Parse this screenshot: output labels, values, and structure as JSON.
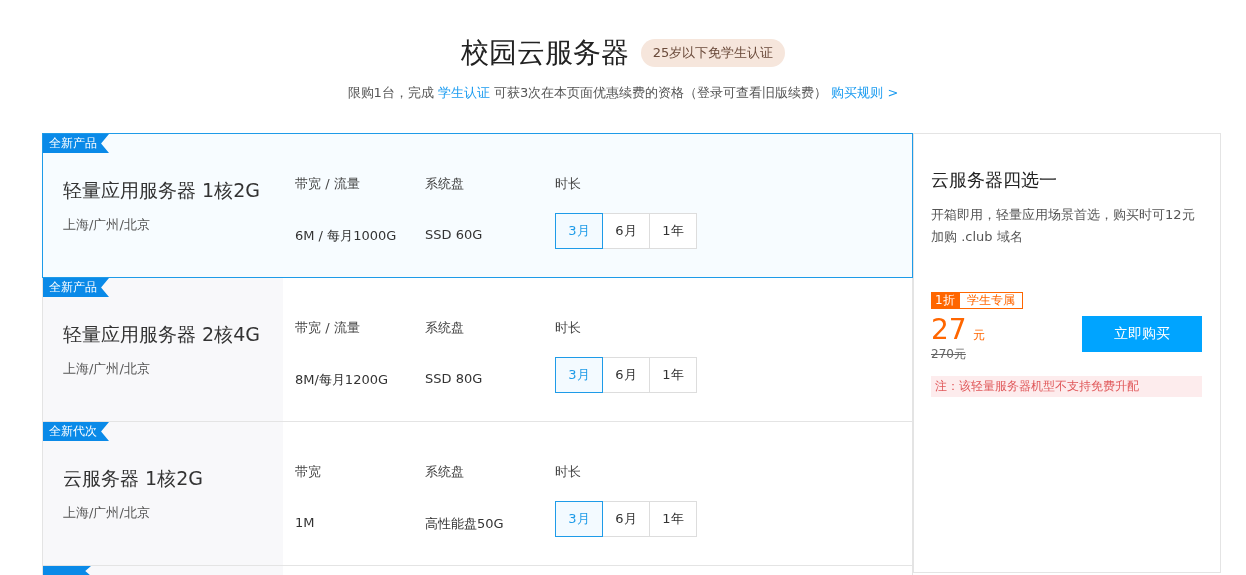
{
  "header": {
    "title": "校园云服务器",
    "badge": "25岁以下免学生认证",
    "subtitle": [
      {
        "kind": "text",
        "text": "限购1台，完成 "
      },
      {
        "kind": "link",
        "text": "学生认证"
      },
      {
        "kind": "text",
        "text": " 可获3次在本页面优惠续费的资格（登录可查看旧版续费） "
      },
      {
        "kind": "link",
        "text": "购买规则 >"
      }
    ]
  },
  "products": [
    {
      "tag": "全新产品",
      "name": "轻量应用服务器 1核2G",
      "regions": "上海/广州/北京",
      "selected": true,
      "specs": [
        {
          "label": "带宽 / 流量",
          "value": "6M / 每月1000G"
        },
        {
          "label": "系统盘",
          "value": "SSD 60G"
        }
      ],
      "duration_label": "时长",
      "durations": [
        {
          "label": "3月",
          "selected": true
        },
        {
          "label": "6月",
          "selected": false
        },
        {
          "label": "1年",
          "selected": false
        }
      ]
    },
    {
      "tag": "全新产品",
      "name": "轻量应用服务器 2核4G",
      "regions": "上海/广州/北京",
      "selected": false,
      "specs": [
        {
          "label": "带宽 / 流量",
          "value": "8M/每月1200G"
        },
        {
          "label": "系统盘",
          "value": "SSD 80G"
        }
      ],
      "duration_label": "时长",
      "durations": [
        {
          "label": "3月",
          "selected": true
        },
        {
          "label": "6月",
          "selected": false
        },
        {
          "label": "1年",
          "selected": false
        }
      ]
    },
    {
      "tag": "全新代次",
      "name": "云服务器 1核2G",
      "regions": "上海/广州/北京",
      "selected": false,
      "specs": [
        {
          "label": "带宽",
          "value": "1M"
        },
        {
          "label": "系统盘",
          "value": "高性能盘50G"
        }
      ],
      "duration_label": "时长",
      "durations": [
        {
          "label": "3月",
          "selected": true
        },
        {
          "label": "6月",
          "selected": false
        },
        {
          "label": "1年",
          "selected": false
        }
      ]
    }
  ],
  "panel": {
    "title": "云服务器四选一",
    "description": "开箱即用，轻量应用场景首选，购买时可12元加购 .club 域名",
    "discount": "1折",
    "discount_note": "学生专属",
    "price": "27",
    "price_unit": "元",
    "old_price": "270元",
    "buy_button": "立即购买",
    "note": "注：该轻量服务器机型不支持免费升配"
  }
}
